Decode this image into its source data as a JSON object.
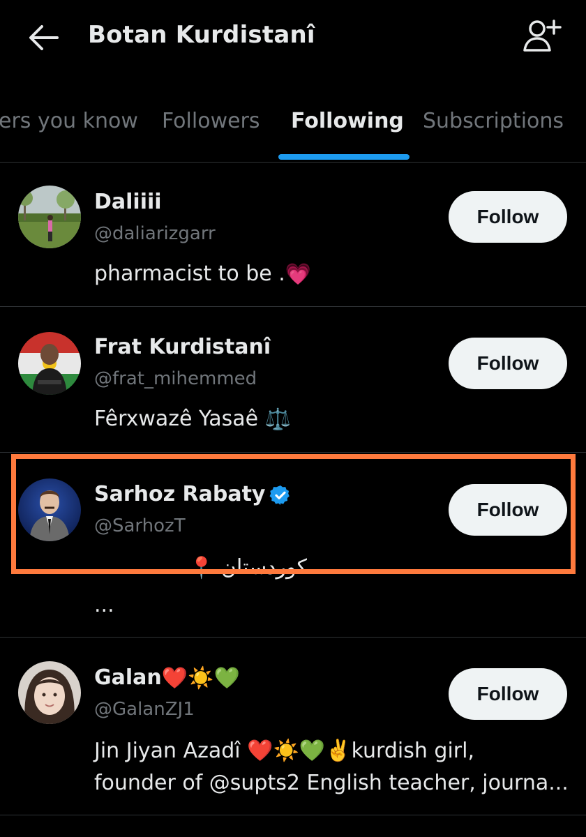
{
  "header": {
    "title": "Botan Kurdistanî",
    "back_icon": "arrow-left-icon",
    "add_user_icon": "add-user-icon"
  },
  "tabs": [
    {
      "label": "ers you know"
    },
    {
      "label": "Followers"
    },
    {
      "label": "Following"
    },
    {
      "label": "Subscriptions"
    }
  ],
  "active_tab": "Following",
  "users": [
    {
      "name": "Daliiii",
      "handle": "@daliarizgarr",
      "bio_text": "pharmacist to be .",
      "bio_emoji": "💗",
      "follow_label": "Follow"
    },
    {
      "name": "Frat Kurdistanî",
      "handle": "@frat_mihemmed",
      "bio_text": "Fêrxwazê Yasaê",
      "bio_emoji": "⚖️",
      "follow_label": "Follow"
    },
    {
      "name": "Sarhoz Rabaty",
      "verified": true,
      "handle": "@SarhozT",
      "bio_text": "کوردستان",
      "bio_emoji": "📍",
      "bio_more": "...",
      "follow_label": "Follow"
    },
    {
      "name": "Galan",
      "name_emojis": "❤️☀️💚",
      "handle": "@GalanZJ1",
      "bio_line1": "Jin Jiyan Azadî ❤️☀️💚✌️kurdish girl,",
      "bio_line2": "founder of @supts2 English teacher, journa...",
      "follow_label": "Follow"
    }
  ],
  "colors": {
    "background": "#000000",
    "accent": "#1d9bf0",
    "highlight": "#ff7a3d",
    "button_bg": "#eff3f4"
  }
}
